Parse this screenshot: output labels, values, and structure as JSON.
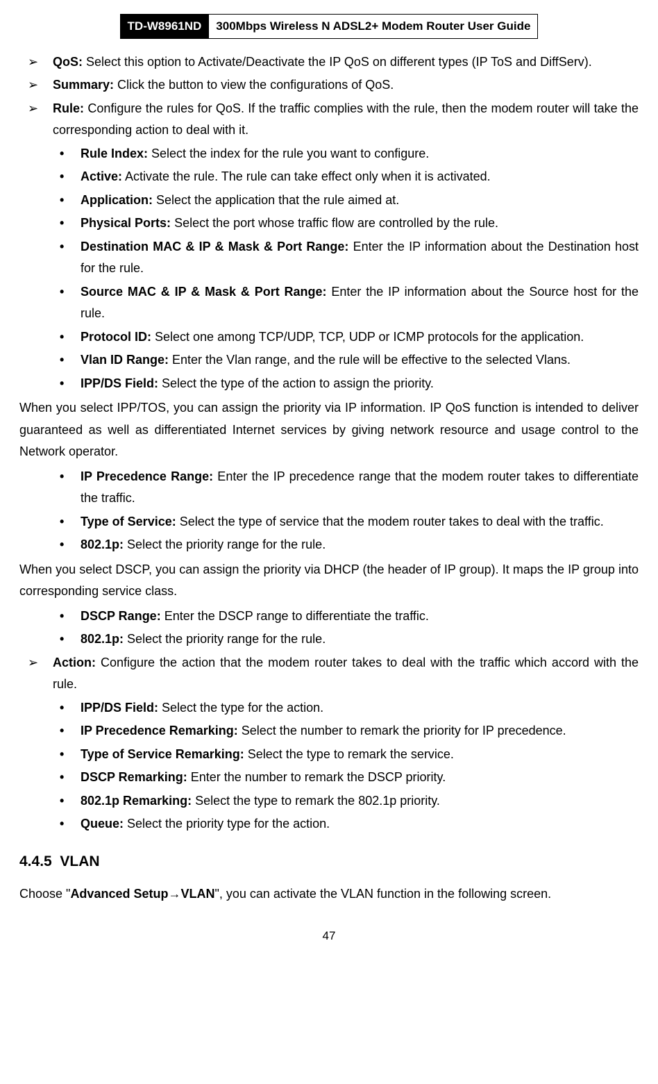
{
  "header": {
    "model": "TD-W8961ND",
    "title": "300Mbps Wireless N ADSL2+ Modem Router User Guide"
  },
  "arrow_items_1": [
    {
      "label": "QoS:",
      "text": " Select this option to Activate/Deactivate the IP QoS on different types (IP ToS and DiffServ)."
    },
    {
      "label": "Summary:",
      "text": " Click the button to view the configurations of QoS."
    },
    {
      "label": "Rule:",
      "text": " Configure the rules for QoS. If the traffic complies with the rule, then the modem router will take the corresponding action to deal with it."
    }
  ],
  "bullets_1": [
    {
      "label": "Rule Index:",
      "text": " Select the index for the rule you want to configure."
    },
    {
      "label": "Active:",
      "text": " Activate the rule. The rule can take effect only when it is activated."
    },
    {
      "label": "Application:",
      "text": " Select the application that the rule aimed at."
    },
    {
      "label": "Physical Ports:",
      "text": " Select the port whose traffic flow are controlled by the rule."
    },
    {
      "label": "Destination MAC & IP & Mask & Port Range:",
      "text": " Enter the IP information about the Destination host for the rule."
    },
    {
      "label": "Source MAC & IP & Mask & Port Range:",
      "text": " Enter the IP information about the Source host for the rule."
    },
    {
      "label": "Protocol ID:",
      "text": " Select one among TCP/UDP, TCP, UDP or ICMP protocols for the application."
    },
    {
      "label": "Vlan ID Range:",
      "text": " Enter the Vlan range, and the rule will be effective to the selected Vlans."
    },
    {
      "label": "IPP/DS Field:",
      "text": " Select the type of the action to assign the priority."
    }
  ],
  "para_1": "When you select IPP/TOS, you can assign the priority via IP information. IP QoS function is intended to deliver guaranteed as well as differentiated Internet services by giving network resource and usage control to the Network operator.",
  "bullets_2": [
    {
      "label": "IP Precedence Range:",
      "text": " Enter the IP precedence range that the modem router takes to differentiate the traffic."
    },
    {
      "label": "Type of Service:",
      "text": " Select the type of service that the modem router takes to deal with the traffic."
    },
    {
      "label": "802.1p:",
      "text": " Select the priority range for the rule."
    }
  ],
  "para_2": "When you select DSCP, you can assign the priority via DHCP (the header of IP group). It maps the IP group into corresponding service class.",
  "bullets_3": [
    {
      "label": "DSCP Range:",
      "text": " Enter the DSCP range to differentiate the traffic."
    },
    {
      "label": "802.1p:",
      "text": " Select the priority range for the rule."
    }
  ],
  "arrow_items_2": [
    {
      "label": "Action:",
      "text": " Configure the action that the modem router takes to deal with the traffic which accord with the rule."
    }
  ],
  "bullets_4": [
    {
      "label": "IPP/DS Field:",
      "text": " Select the type for the action."
    },
    {
      "label": "IP Precedence Remarking:",
      "text": " Select the number to remark the priority for IP precedence."
    },
    {
      "label": "Type of Service Remarking:",
      "text": " Select the type to remark the service."
    },
    {
      "label": "DSCP Remarking:",
      "text": " Enter the number to remark the DSCP priority."
    },
    {
      "label": "802.1p Remarking:",
      "text": " Select the type to remark the 802.1p priority."
    },
    {
      "label": "Queue:",
      "text": " Select the priority type for the action."
    }
  ],
  "section": {
    "number": "4.4.5",
    "title": "VLAN"
  },
  "final_para": {
    "prefix": "Choose \"",
    "bold1": "Advanced Setup",
    "arrow": "→",
    "bold2": "VLAN",
    "suffix": "\", you can activate the VLAN function in the following screen."
  },
  "page_number": "47"
}
